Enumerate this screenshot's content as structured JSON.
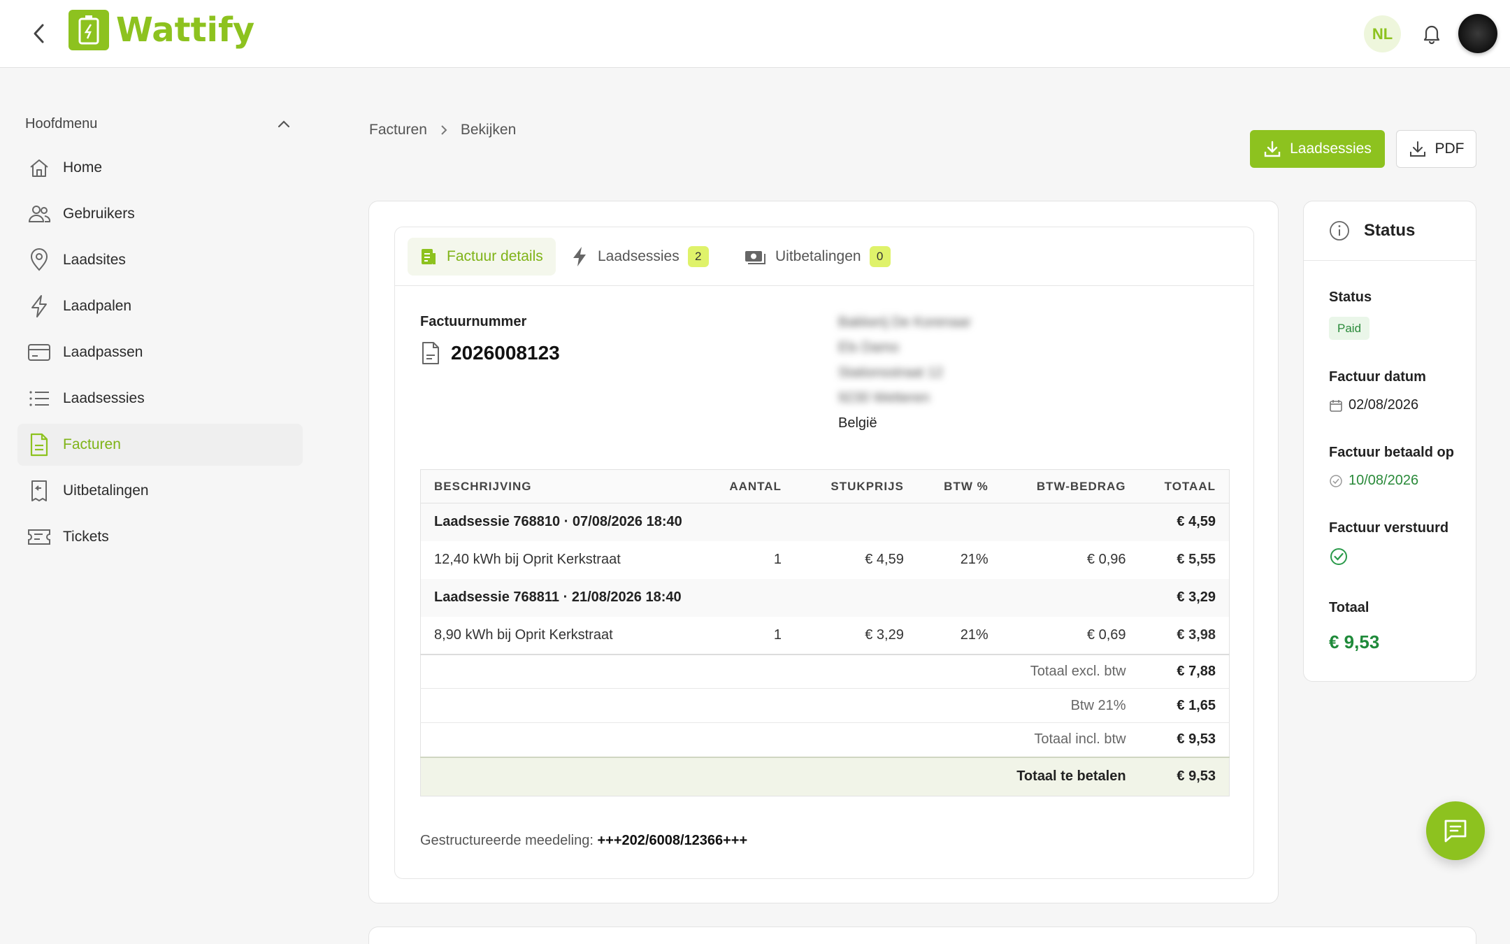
{
  "app": {
    "name": "Wattify"
  },
  "header": {
    "language": "NL",
    "bell_icon": "bell-icon",
    "back_icon": "chevron-left-icon"
  },
  "colors": {
    "brand": "#8dc21f",
    "active_text": "#7fb317",
    "paid_badge_bg": "#eaf6e9",
    "paid_text": "#2a8a3a",
    "count_badge": "#dff26a"
  },
  "sidebar": {
    "heading": "Hoofdmenu",
    "items": [
      {
        "label": "Home",
        "icon": "home-icon"
      },
      {
        "label": "Gebruikers",
        "icon": "users-icon"
      },
      {
        "label": "Laadsites",
        "icon": "map-pin-icon"
      },
      {
        "label": "Laadpalen",
        "icon": "bolt-icon"
      },
      {
        "label": "Laadpassen",
        "icon": "card-icon"
      },
      {
        "label": "Laadsessies",
        "icon": "list-icon"
      },
      {
        "label": "Facturen",
        "icon": "invoice-icon",
        "active": true
      },
      {
        "label": "Uitbetalingen",
        "icon": "receipt-icon"
      },
      {
        "label": "Tickets",
        "icon": "ticket-icon"
      }
    ]
  },
  "breadcrumb": [
    "Facturen",
    "Bekijken"
  ],
  "actions": {
    "laadsessies_label": "Laadsessies",
    "pdf_label": "PDF"
  },
  "tabs": [
    {
      "label": "Factuur details",
      "active": true
    },
    {
      "label": "Laadsessies",
      "count": "2"
    },
    {
      "label": "Uitbetalingen",
      "count": "0"
    }
  ],
  "invoice": {
    "number_label": "Factuurnummer",
    "number": "2026008123",
    "address": {
      "lines_blurred": [
        "Bakkerij De Korenaar",
        "Els Damo",
        "Stationsstraat 12",
        "9230 Wetteren"
      ],
      "country": "België"
    },
    "table": {
      "headers": [
        "BESCHRIJVING",
        "AANTAL",
        "STUKPRIJS",
        "BTW %",
        "BTW-BEDRAG",
        "TOTAAL"
      ],
      "sessions": [
        {
          "title": "Laadsessie 768810 · 07/08/2026 18:40",
          "total": "€ 4,59",
          "line": {
            "description": "12,40 kWh bij Oprit Kerkstraat",
            "qty": "1",
            "unit_price": "€ 4,59",
            "vat_pct": "21%",
            "vat_amount": "€ 0,96",
            "total": "€ 5,55"
          }
        },
        {
          "title": "Laadsessie 768811 · 21/08/2026 18:40",
          "total": "€ 3,29",
          "line": {
            "description": "8,90 kWh bij Oprit Kerkstraat",
            "qty": "1",
            "unit_price": "€ 3,29",
            "vat_pct": "21%",
            "vat_amount": "€ 0,69",
            "total": "€ 3,98"
          }
        }
      ],
      "summary": [
        {
          "label": "Totaal excl. btw",
          "value": "€ 7,88"
        },
        {
          "label": "Btw 21%",
          "value": "€ 1,65"
        },
        {
          "label": "Totaal incl. btw",
          "value": "€ 9,53"
        }
      ],
      "grand_total": {
        "label": "Totaal te betalen",
        "value": "€ 9,53"
      }
    },
    "ogm_label": "Gestructureerde meedeling:",
    "ogm_value": "+++202/6008/12366+++"
  },
  "status_panel": {
    "title": "Status",
    "status_label": "Status",
    "status_value": "Paid",
    "invoice_date_label": "Factuur datum",
    "invoice_date": "02/08/2026",
    "paid_on_label": "Factuur betaald op",
    "paid_on": "10/08/2026",
    "sent_label": "Factuur verstuurd",
    "total_label": "Totaal",
    "total_value": "€ 9,53"
  }
}
